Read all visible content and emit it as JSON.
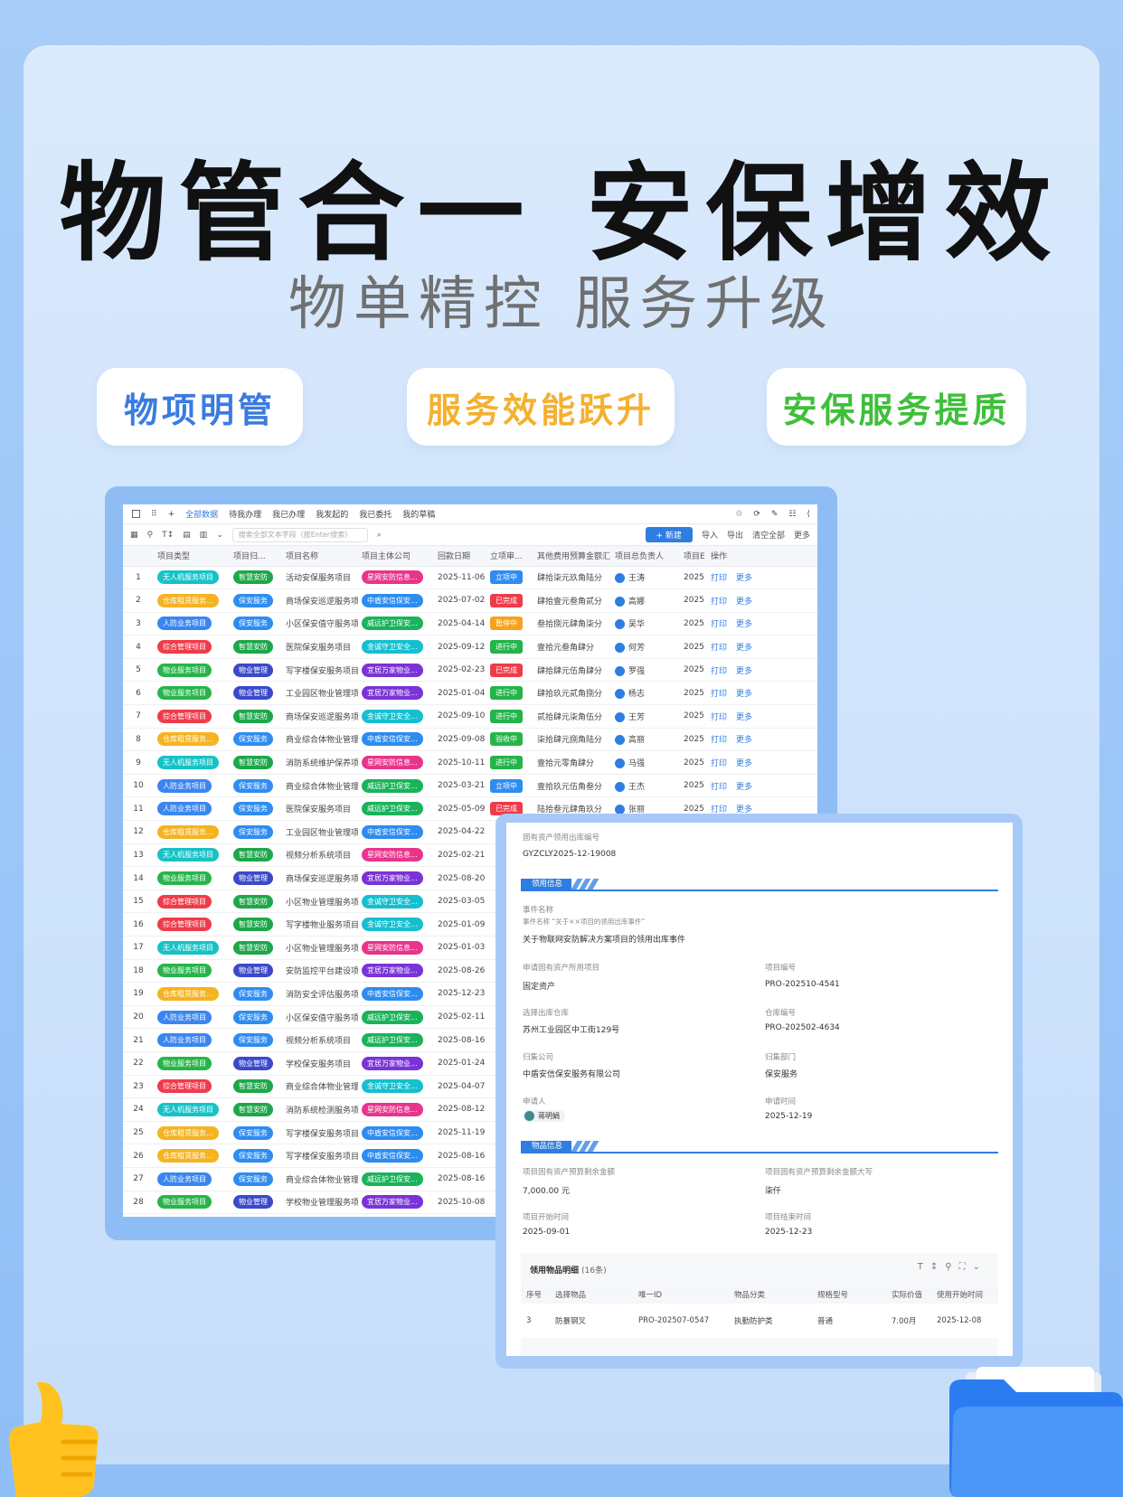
{
  "hero": {
    "title": "物管合一 安保增效",
    "subtitle": "物单精控 服务升级",
    "pills": [
      "物项明管",
      "服务效能跃升",
      "安保服务提质"
    ]
  },
  "colors": {
    "accent": "#2f7de1",
    "pill_blue": "#3a7be0",
    "pill_orange": "#f5b02f",
    "pill_green": "#3fbf3a"
  },
  "table_view": {
    "tabs": [
      "全部数据",
      "待我办理",
      "我已办理",
      "我发起的",
      "我已委托",
      "我的草稿"
    ],
    "search_placeholder": "搜索全部文本字段（按Enter搜索）",
    "new_button": "+ 新建",
    "actions": [
      "导入",
      "导出",
      "清空全部",
      "更多"
    ],
    "columns": [
      "",
      "项目类型",
      "项目归...",
      "项目名称",
      "项目主体公司",
      "回款日期",
      "立项审...",
      "其他费用预算金额汇...",
      "项目总负责人",
      "项目E",
      "操作"
    ],
    "op_print": "打印",
    "op_more": "更多",
    "rows": [
      {
        "n": "1",
        "type": "无人机服务项目",
        "cat": "智慧安防",
        "name": "活动安保服务项目",
        "co": "星网安防信息...",
        "date": "2025-11-06",
        "st": "立项中",
        "amt": "肆拾柒元玖角陆分",
        "mgr": "王涛",
        "y": "2025"
      },
      {
        "n": "2",
        "type": "仓库租赁服务...",
        "cat": "保安服务",
        "name": "商场保安巡逻服务项...",
        "co": "中盾安信保安...",
        "date": "2025-07-02",
        "st": "已完成",
        "amt": "肆拾壹元叁角贰分",
        "mgr": "高娜",
        "y": "2025"
      },
      {
        "n": "3",
        "type": "人防业务项目",
        "cat": "保安服务",
        "name": "小区保安值守服务项...",
        "co": "威远护卫保安...",
        "date": "2025-04-14",
        "st": "暂停中",
        "amt": "叁拾捌元肆角柒分",
        "mgr": "吴华",
        "y": "2025"
      },
      {
        "n": "4",
        "type": "综合管理项目",
        "cat": "智慧安防",
        "name": "医院保安服务项目",
        "co": "金诚守卫安全...",
        "date": "2025-09-12",
        "st": "进行中",
        "amt": "壹拾元叁角肆分",
        "mgr": "何芳",
        "y": "2025"
      },
      {
        "n": "5",
        "type": "物业服务项目",
        "cat": "物业管理",
        "name": "写字楼保安服务项目",
        "co": "宜居万家物业...",
        "date": "2025-02-23",
        "st": "已完成",
        "amt": "肆拾肆元伍角肆分",
        "mgr": "罗强",
        "y": "2025"
      },
      {
        "n": "6",
        "type": "物业服务项目",
        "cat": "物业管理",
        "name": "工业园区物业管理项...",
        "co": "宜居万家物业...",
        "date": "2025-01-04",
        "st": "进行中",
        "amt": "肆拾玖元贰角捌分",
        "mgr": "杨志",
        "y": "2025"
      },
      {
        "n": "7",
        "type": "综合管理项目",
        "cat": "智慧安防",
        "name": "商场保安巡逻服务项...",
        "co": "金诚守卫安全...",
        "date": "2025-09-10",
        "st": "进行中",
        "amt": "贰拾肆元柒角伍分",
        "mgr": "王芳",
        "y": "2025"
      },
      {
        "n": "8",
        "type": "仓库租赁服务...",
        "cat": "保安服务",
        "name": "商业综合体物业管理...",
        "co": "中盾安信保安...",
        "date": "2025-09-08",
        "st": "验收中",
        "amt": "柒拾肆元捌角陆分",
        "mgr": "高丽",
        "y": "2025"
      },
      {
        "n": "9",
        "type": "无人机服务项目",
        "cat": "智慧安防",
        "name": "消防系统维护保养项...",
        "co": "星网安防信息...",
        "date": "2025-10-11",
        "st": "进行中",
        "amt": "壹拾元零角肆分",
        "mgr": "马强",
        "y": "2025"
      },
      {
        "n": "10",
        "type": "人防业务项目",
        "cat": "保安服务",
        "name": "商业综合体物业管理...",
        "co": "威远护卫保安...",
        "date": "2025-03-21",
        "st": "立项中",
        "amt": "壹拾玖元伍角叁分",
        "mgr": "王杰",
        "y": "2025"
      },
      {
        "n": "11",
        "type": "人防业务项目",
        "cat": "保安服务",
        "name": "医院保安服务项目",
        "co": "威远护卫保安...",
        "date": "2025-05-09",
        "st": "已完成",
        "amt": "陆拾叁元肆角玖分",
        "mgr": "张丽",
        "y": "2025"
      },
      {
        "n": "12",
        "type": "仓库租赁服务...",
        "cat": "保安服务",
        "name": "工业园区物业管理项...",
        "co": "中盾安信保安...",
        "date": "2025-04-22",
        "st": "",
        "amt": "",
        "mgr": "",
        "y": ""
      },
      {
        "n": "13",
        "type": "无人机服务项目",
        "cat": "智慧安防",
        "name": "视频分析系统项目",
        "co": "星网安防信息...",
        "date": "2025-02-21",
        "st": "",
        "amt": "",
        "mgr": "",
        "y": ""
      },
      {
        "n": "14",
        "type": "物业服务项目",
        "cat": "物业管理",
        "name": "商场保安巡逻服务项...",
        "co": "宜居万家物业...",
        "date": "2025-08-20",
        "st": "",
        "amt": "",
        "mgr": "",
        "y": ""
      },
      {
        "n": "15",
        "type": "综合管理项目",
        "cat": "智慧安防",
        "name": "小区物业管理服务项...",
        "co": "金诚守卫安全...",
        "date": "2025-03-05",
        "st": "",
        "amt": "",
        "mgr": "",
        "y": ""
      },
      {
        "n": "16",
        "type": "综合管理项目",
        "cat": "智慧安防",
        "name": "写字楼物业服务项目",
        "co": "金诚守卫安全...",
        "date": "2025-01-09",
        "st": "",
        "amt": "",
        "mgr": "",
        "y": ""
      },
      {
        "n": "17",
        "type": "无人机服务项目",
        "cat": "智慧安防",
        "name": "小区物业管理服务项...",
        "co": "星网安防信息...",
        "date": "2025-01-03",
        "st": "",
        "amt": "",
        "mgr": "",
        "y": ""
      },
      {
        "n": "18",
        "type": "物业服务项目",
        "cat": "物业管理",
        "name": "安防监控平台建设项...",
        "co": "宜居万家物业...",
        "date": "2025-08-26",
        "st": "",
        "amt": "",
        "mgr": "",
        "y": ""
      },
      {
        "n": "19",
        "type": "仓库租赁服务...",
        "cat": "保安服务",
        "name": "消防安全评估服务项...",
        "co": "中盾安信保安...",
        "date": "2025-12-23",
        "st": "",
        "amt": "",
        "mgr": "",
        "y": ""
      },
      {
        "n": "20",
        "type": "人防业务项目",
        "cat": "保安服务",
        "name": "小区保安值守服务项...",
        "co": "威远护卫保安...",
        "date": "2025-02-11",
        "st": "",
        "amt": "",
        "mgr": "",
        "y": ""
      },
      {
        "n": "21",
        "type": "人防业务项目",
        "cat": "保安服务",
        "name": "视频分析系统项目",
        "co": "威远护卫保安...",
        "date": "2025-08-16",
        "st": "",
        "amt": "",
        "mgr": "",
        "y": ""
      },
      {
        "n": "22",
        "type": "物业服务项目",
        "cat": "物业管理",
        "name": "学校保安服务项目",
        "co": "宜居万家物业...",
        "date": "2025-01-24",
        "st": "",
        "amt": "",
        "mgr": "",
        "y": ""
      },
      {
        "n": "23",
        "type": "综合管理项目",
        "cat": "智慧安防",
        "name": "商业综合体物业管理...",
        "co": "金诚守卫安全...",
        "date": "2025-04-07",
        "st": "",
        "amt": "",
        "mgr": "",
        "y": ""
      },
      {
        "n": "24",
        "type": "无人机服务项目",
        "cat": "智慧安防",
        "name": "消防系统检测服务项...",
        "co": "星网安防信息...",
        "date": "2025-08-12",
        "st": "",
        "amt": "",
        "mgr": "",
        "y": ""
      },
      {
        "n": "25",
        "type": "仓库租赁服务...",
        "cat": "保安服务",
        "name": "写字楼保安服务项目",
        "co": "中盾安信保安...",
        "date": "2025-11-19",
        "st": "",
        "amt": "",
        "mgr": "",
        "y": ""
      },
      {
        "n": "26",
        "type": "仓库租赁服务...",
        "cat": "保安服务",
        "name": "写字楼保安服务项目",
        "co": "中盾安信保安...",
        "date": "2025-08-16",
        "st": "",
        "amt": "",
        "mgr": "",
        "y": ""
      },
      {
        "n": "27",
        "type": "人防业务项目",
        "cat": "保安服务",
        "name": "商业综合体物业管理...",
        "co": "威远护卫保安...",
        "date": "2025-08-16",
        "st": "",
        "amt": "",
        "mgr": "",
        "y": ""
      },
      {
        "n": "28",
        "type": "物业服务项目",
        "cat": "物业管理",
        "name": "学校物业管理服务项...",
        "co": "宜居万家物业...",
        "date": "2025-10-08",
        "st": "",
        "amt": "",
        "mgr": "",
        "y": ""
      }
    ]
  },
  "detail": {
    "doc_no_label": "固有资产领用出库编号",
    "doc_no": "GYZCLY2025-12-19008",
    "section1": "领用信息",
    "event_label": "事件名称",
    "event_hint": "事件名称 “关于××项目的领用出库事件”",
    "event_value": "关于物联网安防解决方案项目的领用出库事件",
    "f1_label": "申请固有资产所用项目",
    "f1_value": "固定资产",
    "f2_label": "项目编号",
    "f2_value": "PRO-202510-4541",
    "f3_label": "选择出库仓库",
    "f3_value": "苏州工业园区中工街129号",
    "f4_label": "仓库编号",
    "f4_value": "PRO-202502-4634",
    "f5_label": "归集公司",
    "f5_value": "中盾安信保安服务有限公司",
    "f6_label": "归集部门",
    "f6_value": "保安服务",
    "f7_label": "申请人",
    "f7_value": "蒋明娟",
    "f8_label": "申请时间",
    "f8_value": "2025-12-19",
    "section2": "物品信息",
    "g1_label": "项目固有资产预算剩余金额",
    "g1_value": "7,000.00 元",
    "g2_label": "项目固有资产预算剩余金额大写",
    "g2_value": "柒仟",
    "g3_label": "项目开始时间",
    "g3_value": "2025-09-01",
    "g4_label": "项目结束时间",
    "g4_value": "2025-12-23",
    "sub_title": "领用物品明细",
    "sub_count": "(16条)",
    "sub_cols": [
      "序号",
      "选择物品",
      "唯一ID",
      "物品分类",
      "规格型号",
      "实际价值",
      "使用开始时间"
    ],
    "sub_row": [
      "3",
      "防暴钢叉",
      "PRO-202507-0547",
      "执勤防护类",
      "普通",
      "7.00月",
      "2025-12-08"
    ]
  }
}
